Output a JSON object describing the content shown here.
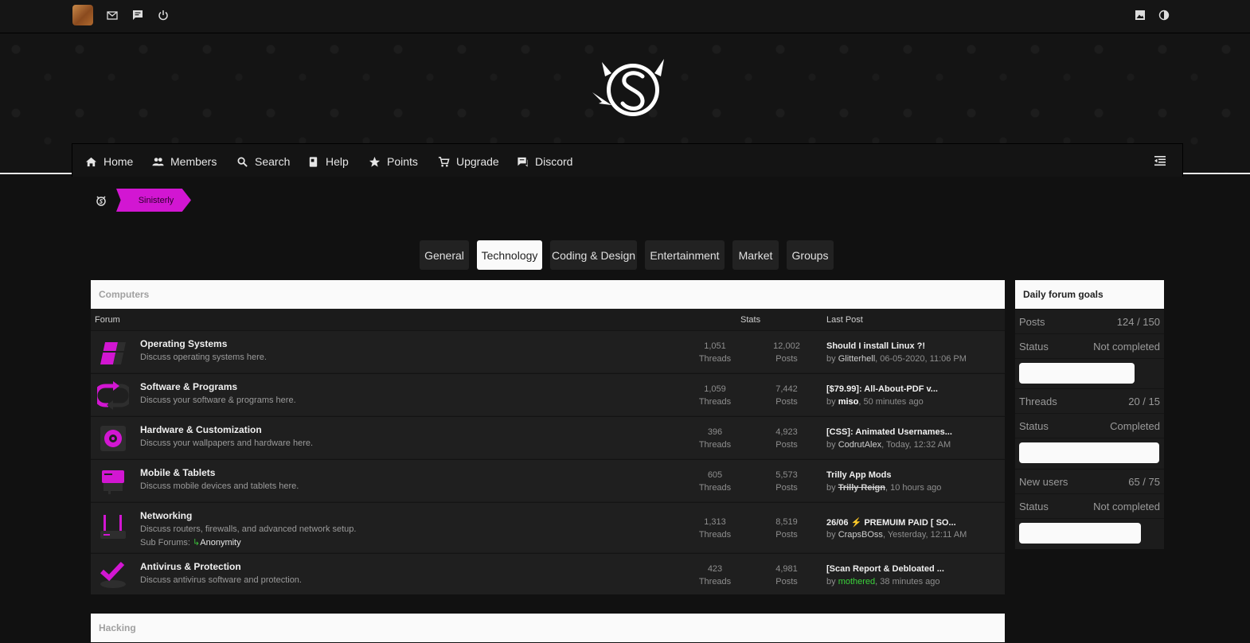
{
  "topbar": {
    "icons": [
      "avatar",
      "mail-icon",
      "chat-icon",
      "power-icon",
      "image-icon",
      "contrast-icon"
    ]
  },
  "nav": {
    "items": [
      {
        "label": "Home",
        "icon": "home-icon"
      },
      {
        "label": "Members",
        "icon": "members-icon"
      },
      {
        "label": "Search",
        "icon": "search-icon"
      },
      {
        "label": "Help",
        "icon": "help-icon"
      },
      {
        "label": "Points",
        "icon": "star-icon"
      },
      {
        "label": "Upgrade",
        "icon": "cart-icon"
      },
      {
        "label": "Discord",
        "icon": "discord-icon"
      }
    ]
  },
  "breadcrumb": {
    "label": "Sinisterly"
  },
  "tabs": [
    "General",
    "Technology",
    "Coding & Design",
    "Entertainment",
    "Market",
    "Groups"
  ],
  "active_tab": "Technology",
  "colors": {
    "accent": "#d216d2",
    "background": "#111111",
    "row": "#1f1f1f",
    "green": "#3bd13b"
  },
  "computers": {
    "title": "Computers",
    "col_forum": "Forum",
    "col_stats": "Stats",
    "col_last": "Last Post",
    "threads_label": "Threads",
    "posts_label": "Posts",
    "by_label": "by",
    "rows": [
      {
        "title": "Operating Systems",
        "desc": "Discuss operating systems here.",
        "threads": "1,051",
        "posts": "12,002",
        "last_title": "Should I install Linux ?!",
        "last_user": "Glitterhell",
        "last_time": ", 06-05-2020, 11:06 PM"
      },
      {
        "title": "Software & Programs",
        "desc": "Discuss your software & programs here.",
        "threads": "1,059",
        "posts": "7,442",
        "last_title": "[$79.99]: All-About-PDF v...",
        "last_user": "miso",
        "last_time": ", 50 minutes ago"
      },
      {
        "title": "Hardware & Customization",
        "desc": "Discuss your wallpapers and hardware here.",
        "threads": "396",
        "posts": "4,923",
        "last_title": "[CSS]: Animated Usernames...",
        "last_user": "CodrutAlex",
        "last_time": ", Today, 12:32 AM"
      },
      {
        "title": "Mobile & Tablets",
        "desc": "Discuss mobile devices and tablets here.",
        "threads": "605",
        "posts": "5,573",
        "last_title": "Trilly App Mods",
        "last_user": "Trilly Reign",
        "last_time": ", 10 hours ago"
      },
      {
        "title": "Networking",
        "desc": "Discuss routers, firewalls, and advanced network setup.",
        "sub_label": "Sub Forums:",
        "sub_arrow": "↳",
        "sub_link": "Anonymity",
        "threads": "1,313",
        "posts": "8,519",
        "last_title": "26/06 ⚡ PREMUIM PAID [ SO...",
        "last_user": "CrapsBOss",
        "last_time": ", Yesterday, 12:11 AM"
      },
      {
        "title": "Antivirus & Protection",
        "desc": "Discuss antivirus software and protection.",
        "threads": "423",
        "posts": "4,981",
        "last_title": "[Scan Report & Debloated ...",
        "last_user": "mothered",
        "last_time": ", 38 minutes ago"
      }
    ]
  },
  "hacking": {
    "title": "Hacking"
  },
  "goals": {
    "title": "Daily forum goals",
    "items": [
      {
        "label": "Posts",
        "value": "124 / 150",
        "status_label": "Status",
        "status": "Not completed",
        "progress": 0.8267
      },
      {
        "label": "Threads",
        "value": "20 / 15",
        "status_label": "Status",
        "status": "Completed",
        "progress": 1.0
      },
      {
        "label": "New users",
        "value": "65 / 75",
        "status_label": "Status",
        "status": "Not completed",
        "progress": 0.8667
      }
    ]
  }
}
